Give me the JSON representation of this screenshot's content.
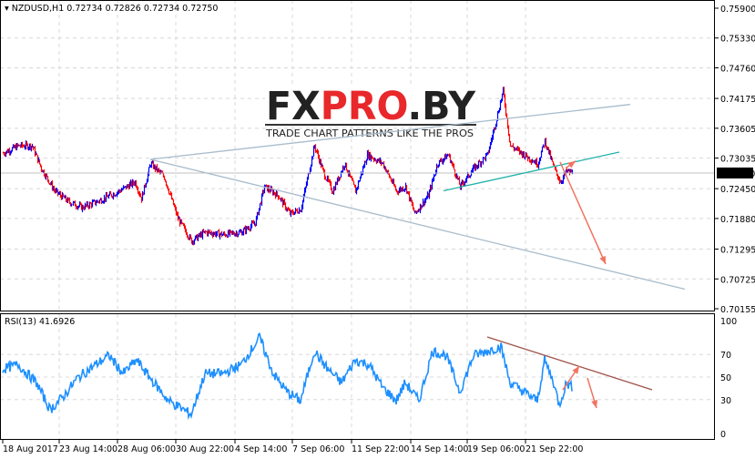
{
  "header": {
    "symbol": "NZDUSD,H1",
    "ohlc": "0.72734 0.72826 0.72734 0.72750"
  },
  "rsi_header": "RSI(13) 41.6926",
  "watermark": {
    "brand": "FXPRO.BY",
    "tagline": "TRADE CHART PATTERNS LIKE THE PROS"
  },
  "colors": {
    "bull": "#0000ff",
    "bear": "#ff0000",
    "rsi": "#1e90ff",
    "grid": "#d8d8d8",
    "wedge": "#a8bccc",
    "support": "#20b2aa",
    "arrow": "#f27360",
    "rsi_trend": "#a0524a"
  },
  "chart_data": [
    {
      "type": "line",
      "title": "NZDUSD,H1",
      "current_price": "0.72750",
      "yticks": [
        "0.75900",
        "0.75330",
        "0.74760",
        "0.74175",
        "0.73605",
        "0.73035",
        "0.72450",
        "0.71880",
        "0.71295",
        "0.70725",
        "0.70155"
      ],
      "ylim": [
        0.70155,
        0.759
      ],
      "xlabels": [
        "18 Aug 2017",
        "23 Aug 14:00",
        "28 Aug 06:00",
        "30 Aug 22:00",
        "4 Sep 14:00",
        "7 Sep 06:00",
        "11 Sep 22:00",
        "14 Sep 14:00",
        "19 Sep 06:00",
        "21 Sep 22:00"
      ],
      "xlabel_bars": [
        3,
        65,
        129,
        193,
        258,
        321,
        386,
        451,
        513,
        577
      ],
      "xlim": [
        0,
        785
      ],
      "series": [
        {
          "name": "price",
          "points": [
            [
              3,
              0.7313
            ],
            [
              20,
              0.7327
            ],
            [
              35,
              0.7327
            ],
            [
              45,
              0.7284
            ],
            [
              60,
              0.724
            ],
            [
              75,
              0.722
            ],
            [
              90,
              0.7209
            ],
            [
              110,
              0.7223
            ],
            [
              130,
              0.724
            ],
            [
              148,
              0.7258
            ],
            [
              155,
              0.7226
            ],
            [
              165,
              0.7293
            ],
            [
              180,
              0.7267
            ],
            [
              195,
              0.7188
            ],
            [
              210,
              0.7145
            ],
            [
              225,
              0.7162
            ],
            [
              245,
              0.7157
            ],
            [
              265,
              0.7162
            ],
            [
              280,
              0.718
            ],
            [
              290,
              0.7249
            ],
            [
              305,
              0.7232
            ],
            [
              318,
              0.7197
            ],
            [
              330,
              0.7206
            ],
            [
              345,
              0.7327
            ],
            [
              355,
              0.7275
            ],
            [
              365,
              0.724
            ],
            [
              378,
              0.7293
            ],
            [
              390,
              0.724
            ],
            [
              403,
              0.731
            ],
            [
              420,
              0.7293
            ],
            [
              435,
              0.724
            ],
            [
              445,
              0.7249
            ],
            [
              455,
              0.7197
            ],
            [
              470,
              0.7232
            ],
            [
              480,
              0.7293
            ],
            [
              492,
              0.731
            ],
            [
              505,
              0.7249
            ],
            [
              520,
              0.7284
            ],
            [
              535,
              0.731
            ],
            [
              545,
              0.738
            ],
            [
              552,
              0.7432
            ],
            [
              560,
              0.7327
            ],
            [
              575,
              0.731
            ],
            [
              590,
              0.7293
            ],
            [
              598,
              0.7336
            ],
            [
              608,
              0.7284
            ],
            [
              615,
              0.7258
            ],
            [
              622,
              0.7278
            ],
            [
              628,
              0.7275
            ]
          ]
        }
      ],
      "lines": [
        {
          "name": "wedge-upper",
          "from": [
            165,
            0.7301
          ],
          "to": [
            692,
            0.7406
          ]
        },
        {
          "name": "wedge-lower",
          "from": [
            165,
            0.7301
          ],
          "to": [
            752,
            0.7053
          ]
        },
        {
          "name": "support",
          "from": [
            487,
            0.7241
          ],
          "to": [
            680,
            0.7315
          ]
        }
      ],
      "arrows": [
        {
          "name": "arrow-down",
          "from": [
            615,
            0.7296
          ],
          "to": [
            665,
            0.7101
          ]
        },
        {
          "name": "arrow-up",
          "from": [
            621,
            0.7284
          ],
          "to": [
            632,
            0.7298
          ]
        }
      ]
    },
    {
      "type": "line",
      "title": "RSI(13) 41.6926",
      "yticks": [
        "100",
        "70",
        "50",
        "30",
        "0"
      ],
      "ylim": [
        0,
        100
      ],
      "series": [
        {
          "name": "RSI(13)",
          "points": [
            [
              3,
              57
            ],
            [
              20,
              61
            ],
            [
              40,
              45
            ],
            [
              55,
              21
            ],
            [
              70,
              33
            ],
            [
              85,
              49
            ],
            [
              105,
              61
            ],
            [
              120,
              69
            ],
            [
              135,
              53
            ],
            [
              150,
              65
            ],
            [
              165,
              49
            ],
            [
              185,
              29
            ],
            [
              210,
              17
            ],
            [
              225,
              53
            ],
            [
              245,
              53
            ],
            [
              265,
              61
            ],
            [
              285,
              85
            ],
            [
              300,
              53
            ],
            [
              315,
              37
            ],
            [
              330,
              29
            ],
            [
              345,
              73
            ],
            [
              360,
              57
            ],
            [
              375,
              45
            ],
            [
              390,
              65
            ],
            [
              405,
              61
            ],
            [
              420,
              41
            ],
            [
              435,
              29
            ],
            [
              445,
              45
            ],
            [
              460,
              29
            ],
            [
              475,
              73
            ],
            [
              490,
              69
            ],
            [
              505,
              37
            ],
            [
              520,
              69
            ],
            [
              535,
              73
            ],
            [
              550,
              77
            ],
            [
              560,
              45
            ],
            [
              575,
              37
            ],
            [
              590,
              29
            ],
            [
              598,
              65
            ],
            [
              608,
              45
            ],
            [
              614,
              25
            ],
            [
              622,
              45
            ],
            [
              628,
              41
            ]
          ]
        }
      ],
      "lines": [
        {
          "name": "rsi-trend",
          "from": [
            535,
            85.5
          ],
          "to": [
            716,
            38.7
          ]
        }
      ],
      "arrows": [
        {
          "name": "rsi-arrow-up",
          "from": [
            618,
            38.7
          ],
          "to": [
            636,
            59.7
          ]
        },
        {
          "name": "rsi-arrow-down",
          "from": [
            645,
            49.2
          ],
          "to": [
            655,
            22.6
          ]
        }
      ]
    }
  ]
}
